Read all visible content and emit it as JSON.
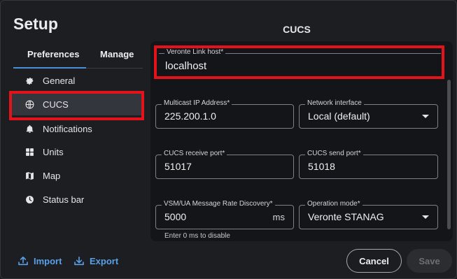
{
  "dialog": {
    "title": "Setup"
  },
  "tabs": [
    {
      "label": "Preferences"
    },
    {
      "label": "Manage"
    }
  ],
  "sidebar": {
    "items": [
      {
        "label": "General",
        "icon": "gear-icon"
      },
      {
        "label": "CUCS",
        "icon": "globe-icon"
      },
      {
        "label": "Notifications",
        "icon": "bell-icon"
      },
      {
        "label": "Units",
        "icon": "grid-icon"
      },
      {
        "label": "Map",
        "icon": "map-icon"
      },
      {
        "label": "Status bar",
        "icon": "clock-icon"
      }
    ]
  },
  "panel": {
    "title": "CUCS",
    "host": {
      "label": "Veronte Link host*",
      "value": "localhost"
    },
    "multicast": {
      "label": "Multicast IP Address*",
      "value": "225.200.1.0"
    },
    "network": {
      "label": "Network interface",
      "value": "Local (default)"
    },
    "receive_port": {
      "label": "CUCS receive port*",
      "value": "51017"
    },
    "send_port": {
      "label": "CUCS send port*",
      "value": "51018"
    },
    "rate": {
      "label": "VSM/UA Message Rate Discovery*",
      "value": "5000",
      "unit": "ms",
      "hint": "Enter 0 ms to disable"
    },
    "mode": {
      "label": "Operation mode*",
      "value": "Veronte STANAG"
    }
  },
  "footer": {
    "import_label": "Import",
    "export_label": "Export",
    "cancel_label": "Cancel",
    "save_label": "Save"
  },
  "colors": {
    "accent": "#5aa0e8",
    "highlight": "#e3121b",
    "panel_bg": "#141518"
  }
}
